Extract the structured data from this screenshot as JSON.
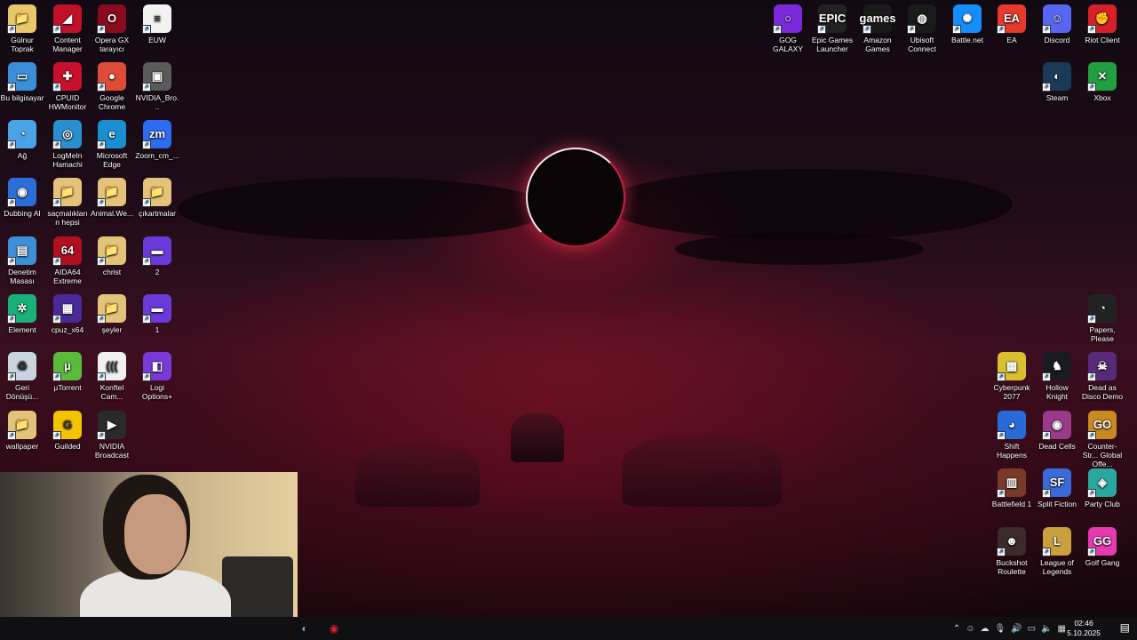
{
  "desktop": {
    "icons_left": [
      {
        "label": "Gülnur Toprak",
        "icon": "user-folder-icon",
        "color": "#e8c66a",
        "glyph": "📁"
      },
      {
        "label": "Content Manager",
        "icon": "content-manager-icon",
        "color": "#c0102a",
        "glyph": "◢"
      },
      {
        "label": "Opera GX tarayıcı",
        "icon": "opera-gx-icon",
        "color": "#8a0b1e",
        "glyph": "O"
      },
      {
        "label": "EUW",
        "icon": "text-file-icon",
        "color": "#f2f2f2",
        "glyph": "≡"
      },
      {
        "label": "Bu bilgisayar",
        "icon": "this-pc-icon",
        "color": "#3b8fd8",
        "glyph": "▭"
      },
      {
        "label": "CPUID HWMonitor",
        "icon": "hwmonitor-icon",
        "color": "#c8102e",
        "glyph": "✚"
      },
      {
        "label": "Google Chrome",
        "icon": "chrome-icon",
        "color": "#dd4b39",
        "glyph": "●"
      },
      {
        "label": "NVIDIA_Bro...",
        "icon": "nvidia-file-icon",
        "color": "#5a5a5a",
        "glyph": "▣"
      },
      {
        "label": "Ağ",
        "icon": "network-icon",
        "color": "#4aa3e6",
        "glyph": "◔"
      },
      {
        "label": "LogMeIn Hamachi",
        "icon": "hamachi-icon",
        "color": "#2a8fd0",
        "glyph": "◎"
      },
      {
        "label": "Microsoft Edge",
        "icon": "edge-icon",
        "color": "#1a8fd0",
        "glyph": "e"
      },
      {
        "label": "Zoom_cm_...",
        "icon": "zoom-icon",
        "color": "#2d6cf0",
        "glyph": "zm"
      },
      {
        "label": "Dubbing AI",
        "icon": "dubbing-ai-icon",
        "color": "#2b6ed8",
        "glyph": "◉"
      },
      {
        "label": "saçmalıkların hepsi",
        "icon": "folder-icon",
        "color": "#e3c27a",
        "glyph": "📁"
      },
      {
        "label": "Animal.We...",
        "icon": "folder-icon",
        "color": "#e3c27a",
        "glyph": "📁"
      },
      {
        "label": "çıkartmalar",
        "icon": "folder-icon",
        "color": "#e3c27a",
        "glyph": "📁"
      },
      {
        "label": "Denetim Masası",
        "icon": "control-panel-icon",
        "color": "#3d8fd8",
        "glyph": "▤"
      },
      {
        "label": "AIDA64 Extreme",
        "icon": "aida64-icon",
        "color": "#b01020",
        "glyph": "64"
      },
      {
        "label": "christ",
        "icon": "folder-icon",
        "color": "#e3c27a",
        "glyph": "📁"
      },
      {
        "label": "2",
        "icon": "image-file-icon",
        "color": "#6a3ad8",
        "glyph": "▬"
      },
      {
        "label": "Element",
        "icon": "element-icon",
        "color": "#1ab07a",
        "glyph": "✲"
      },
      {
        "label": "cpuz_x64",
        "icon": "cpuz-icon",
        "color": "#4a2a9a",
        "glyph": "▦"
      },
      {
        "label": "şeyler",
        "icon": "folder-icon",
        "color": "#e3c27a",
        "glyph": "📁"
      },
      {
        "label": "1",
        "icon": "image-file-icon",
        "color": "#6a3ad8",
        "glyph": "▬"
      },
      {
        "label": "Geri Dönüşü...",
        "icon": "recycle-bin-icon",
        "color": "#c8d4de",
        "glyph": "♻"
      },
      {
        "label": "µTorrent",
        "icon": "utorrent-icon",
        "color": "#5aba3a",
        "glyph": "µ"
      },
      {
        "label": "Konftel Cam...",
        "icon": "konftel-icon",
        "color": "#f0f0f0",
        "glyph": "((("
      },
      {
        "label": "Logi Options+",
        "icon": "logi-options-icon",
        "color": "#7a3ad8",
        "glyph": "◧"
      },
      {
        "label": "wallpaper",
        "icon": "folder-icon",
        "color": "#e3c27a",
        "glyph": "📁"
      },
      {
        "label": "Guilded",
        "icon": "guilded-icon",
        "color": "#f5c400",
        "glyph": "G"
      },
      {
        "label": "NVIDIA Broadcast",
        "icon": "nvidia-broadcast-icon",
        "color": "#2a2a2a",
        "glyph": "▶"
      }
    ],
    "icons_top_right": [
      {
        "label": "GOG GALAXY",
        "icon": "gog-galaxy-icon",
        "color": "#7a2ad8",
        "glyph": "○"
      },
      {
        "label": "Epic Games Launcher",
        "icon": "epic-games-icon",
        "color": "#222",
        "glyph": "EPIC"
      },
      {
        "label": "Amazon Games",
        "icon": "amazon-games-icon",
        "color": "#1a1a1a",
        "glyph": "games"
      },
      {
        "label": "Ubisoft Connect",
        "icon": "ubisoft-icon",
        "color": "#1a1a1a",
        "glyph": "◍"
      },
      {
        "label": "Battle.net",
        "icon": "battlenet-icon",
        "color": "#148eff",
        "glyph": "✺"
      },
      {
        "label": "EA",
        "icon": "ea-icon",
        "color": "#e83a2a",
        "glyph": "EA"
      },
      {
        "label": "Discord",
        "icon": "discord-icon",
        "color": "#5865f2",
        "glyph": "☺"
      },
      {
        "label": "Riot Client",
        "icon": "riot-client-icon",
        "color": "#d8202a",
        "glyph": "✊"
      },
      {
        "label": "Steam",
        "icon": "steam-icon",
        "color": "#1b3a5a",
        "glyph": "◐"
      },
      {
        "label": "Xbox",
        "icon": "xbox-icon",
        "color": "#22a040",
        "glyph": "✕"
      }
    ],
    "icons_right": [
      {
        "label": "Papers, Please",
        "icon": "papers-please-icon",
        "color": "#222",
        "glyph": "◔"
      },
      {
        "label": "Cyberpunk 2077",
        "icon": "cyberpunk-icon",
        "color": "#d8c030",
        "glyph": "▩"
      },
      {
        "label": "Hollow Knight",
        "icon": "hollow-knight-icon",
        "color": "#1a1a22",
        "glyph": "♞"
      },
      {
        "label": "Dead as Disco Demo",
        "icon": "dead-as-disco-icon",
        "color": "#5a2a7a",
        "glyph": "☠"
      },
      {
        "label": "Shift Happens",
        "icon": "shift-happens-icon",
        "color": "#2a6ad8",
        "glyph": "◕"
      },
      {
        "label": "Dead Cells",
        "icon": "dead-cells-icon",
        "color": "#9a3a8a",
        "glyph": "◉"
      },
      {
        "label": "Counter-Str... Global Offe...",
        "icon": "csgo-icon",
        "color": "#c88a20",
        "glyph": "GO"
      },
      {
        "label": "Battlefield 1",
        "icon": "battlefield-icon",
        "color": "#7a3a2a",
        "glyph": "▥"
      },
      {
        "label": "Split Fiction",
        "icon": "split-fiction-icon",
        "color": "#3a6ad8",
        "glyph": "SF"
      },
      {
        "label": "Party Club",
        "icon": "party-club-icon",
        "color": "#2aa8a0",
        "glyph": "◈"
      },
      {
        "label": "Buckshot Roulette",
        "icon": "buckshot-roulette-icon",
        "color": "#3a2a2a",
        "glyph": "☻"
      },
      {
        "label": "League of Legends",
        "icon": "league-icon",
        "color": "#c8a040",
        "glyph": "L"
      },
      {
        "label": "Golf Gang",
        "icon": "golf-gang-icon",
        "color": "#e83ab0",
        "glyph": "GG"
      }
    ]
  },
  "taskbar": {
    "apps": [
      {
        "name": "steam-taskbar-icon",
        "glyph": "◐",
        "color": "#6aa8d8"
      },
      {
        "name": "screen-recorder-taskbar-icon",
        "glyph": "◉",
        "color": "#e02030"
      }
    ],
    "tray": [
      {
        "name": "chevron-up-icon",
        "glyph": "⌃"
      },
      {
        "name": "discord-tray-icon",
        "glyph": "☺"
      },
      {
        "name": "cloud-tray-icon",
        "glyph": "☁"
      },
      {
        "name": "microphone-icon",
        "glyph": "🎙"
      },
      {
        "name": "volume-icon",
        "glyph": "🔊"
      },
      {
        "name": "network-tray-icon",
        "glyph": "▭"
      },
      {
        "name": "speaker-tray-icon",
        "glyph": "🔈"
      },
      {
        "name": "keyboard-tray-icon",
        "glyph": "▦"
      }
    ],
    "time": "02:46",
    "date": "5.10.2025",
    "notification_glyph": "▤"
  }
}
